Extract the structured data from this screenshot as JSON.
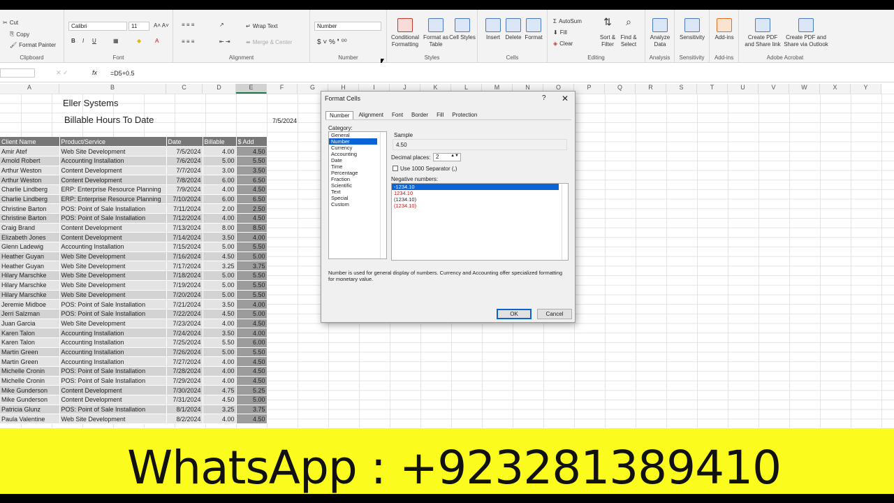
{
  "ribbon": {
    "clipboard": {
      "cut": "Cut",
      "copy": "Copy",
      "format_painter": "Format Painter",
      "label": "Clipboard"
    },
    "font": {
      "name": "Calibri",
      "size": "11",
      "label": "Font"
    },
    "alignment": {
      "wrap_text": "Wrap Text",
      "merge": "Merge & Center",
      "label": "Alignment"
    },
    "number": {
      "format": "Number",
      "label": "Number"
    },
    "styles": {
      "conditional": "Conditional Formatting",
      "format_table": "Format as Table",
      "cell_styles": "Cell Styles",
      "label": "Styles"
    },
    "cells": {
      "insert": "Insert",
      "delete": "Delete",
      "format": "Format",
      "label": "Cells"
    },
    "editing": {
      "autosum": "AutoSum",
      "fill": "Fill",
      "clear": "Clear",
      "sort": "Sort & Filter",
      "find": "Find & Select",
      "label": "Editing"
    },
    "analysis": {
      "analyze": "Analyze Data",
      "label": "Analysis"
    },
    "sensitivity": {
      "btn": "Sensitivity",
      "label": "Sensitivity"
    },
    "addins": {
      "btn": "Add-ins",
      "label": "Add-ins"
    },
    "acrobat": {
      "pdf1": "Create PDF and Share link",
      "pdf2": "Create PDF and Share via Outlook",
      "label": "Adobe Acrobat"
    }
  },
  "formula_bar": {
    "fx": "fx",
    "formula": "=D5+0.5"
  },
  "columns": [
    "A",
    "B",
    "C",
    "D",
    "E",
    "F",
    "G",
    "H",
    "I",
    "J",
    "K",
    "L",
    "M",
    "N",
    "O",
    "P",
    "Q",
    "R",
    "S",
    "T",
    "U",
    "V",
    "W",
    "X",
    "Y"
  ],
  "sheet": {
    "title": "Eller Systems",
    "subtitle": "Billable Hours To Date",
    "date": "7/5/2024",
    "headers": [
      "Client Name",
      "Product/Service",
      "Date",
      "Billable",
      "$ Add"
    ],
    "rows": [
      [
        "Amir Atef",
        "Web Site Development",
        "7/5/2024",
        "4.00",
        "4.50"
      ],
      [
        "Arnold Robert",
        "Accounting Installation",
        "7/6/2024",
        "5.00",
        "5.50"
      ],
      [
        "Arthur Weston",
        "Content Development",
        "7/7/2024",
        "3.00",
        "3.50"
      ],
      [
        "Arthur Weston",
        "Content Development",
        "7/8/2024",
        "6.00",
        "6.50"
      ],
      [
        "Charlie Lindberg",
        "ERP: Enterprise Resource Planning",
        "7/9/2024",
        "4.00",
        "4.50"
      ],
      [
        "Charlie Lindberg",
        "ERP: Enterprise Resource Planning",
        "7/10/2024",
        "6.00",
        "6.50"
      ],
      [
        "Christine Barton",
        "POS: Point of Sale Installation",
        "7/11/2024",
        "2.00",
        "2.50"
      ],
      [
        "Christine Barton",
        "POS: Point of Sale Installation",
        "7/12/2024",
        "4.00",
        "4.50"
      ],
      [
        "Craig Brand",
        "Content Development",
        "7/13/2024",
        "8.00",
        "8.50"
      ],
      [
        "Elizabeth Jones",
        "Content Development",
        "7/14/2024",
        "3.50",
        "4.00"
      ],
      [
        "Glenn Ladewig",
        "Accounting Installation",
        "7/15/2024",
        "5.00",
        "5.50"
      ],
      [
        "Heather Guyan",
        "Web Site Development",
        "7/16/2024",
        "4.50",
        "5.00"
      ],
      [
        "Heather Guyan",
        "Web Site Development",
        "7/17/2024",
        "3.25",
        "3.75"
      ],
      [
        "Hilary Marschke",
        "Web Site Development",
        "7/18/2024",
        "5.00",
        "5.50"
      ],
      [
        "Hilary Marschke",
        "Web Site Development",
        "7/19/2024",
        "5.00",
        "5.50"
      ],
      [
        "Hilary Marschke",
        "Web Site Development",
        "7/20/2024",
        "5.00",
        "5.50"
      ],
      [
        "Jeremie Midboe",
        "POS: Point of Sale Installation",
        "7/21/2024",
        "3.50",
        "4.00"
      ],
      [
        "Jerri Salzman",
        "POS: Point of Sale Installation",
        "7/22/2024",
        "4.50",
        "5.00"
      ],
      [
        "Juan Garcia",
        "Web Site Development",
        "7/23/2024",
        "4.00",
        "4.50"
      ],
      [
        "Karen Talon",
        "Accounting Installation",
        "7/24/2024",
        "3.50",
        "4.00"
      ],
      [
        "Karen Talon",
        "Accounting Installation",
        "7/25/2024",
        "5.50",
        "6.00"
      ],
      [
        "Martin Green",
        "Accounting Installation",
        "7/26/2024",
        "5.00",
        "5.50"
      ],
      [
        "Martin Green",
        "Accounting Installation",
        "7/27/2024",
        "4.00",
        "4.50"
      ],
      [
        "Michelle Cronin",
        "POS: Point of Sale Installation",
        "7/28/2024",
        "4.00",
        "4.50"
      ],
      [
        "Michelle Cronin",
        "POS: Point of Sale Installation",
        "7/29/2024",
        "4.00",
        "4.50"
      ],
      [
        "Mike Gunderson",
        "Content Development",
        "7/30/2024",
        "4.75",
        "5.25"
      ],
      [
        "Mike Gunderson",
        "Content Development",
        "7/31/2024",
        "4.50",
        "5.00"
      ],
      [
        "Patricia Glunz",
        "POS: Point of Sale Installation",
        "8/1/2024",
        "3.25",
        "3.75"
      ],
      [
        "Paula Valentine",
        "Web Site Development",
        "8/2/2024",
        "4.00",
        "4.50"
      ]
    ]
  },
  "dialog": {
    "title": "Format Cells",
    "help": "?",
    "close": "✕",
    "tabs": [
      "Number",
      "Alignment",
      "Font",
      "Border",
      "Fill",
      "Protection"
    ],
    "category_label": "Category:",
    "categories": [
      "General",
      "Number",
      "Currency",
      "Accounting",
      "Date",
      "Time",
      "Percentage",
      "Fraction",
      "Scientific",
      "Text",
      "Special",
      "Custom"
    ],
    "sample_label": "Sample",
    "sample_value": "4.50",
    "decimal_label": "Decimal places:",
    "decimal_value": "2",
    "separator_label": "Use 1000 Separator (,)",
    "negative_label": "Negative numbers:",
    "negatives": [
      "-1234.10",
      "1234.10",
      "(1234.10)",
      "(1234.10)"
    ],
    "description": "Number is used for general display of numbers. Currency and Accounting offer specialized formatting for monetary value.",
    "ok": "OK",
    "cancel": "Cancel"
  },
  "banner": {
    "text": "WhatsApp : +923281389410"
  },
  "colors": {
    "banner": "#fbfc1d",
    "selection": "#0a64d8",
    "negative_red": "#d01010"
  }
}
